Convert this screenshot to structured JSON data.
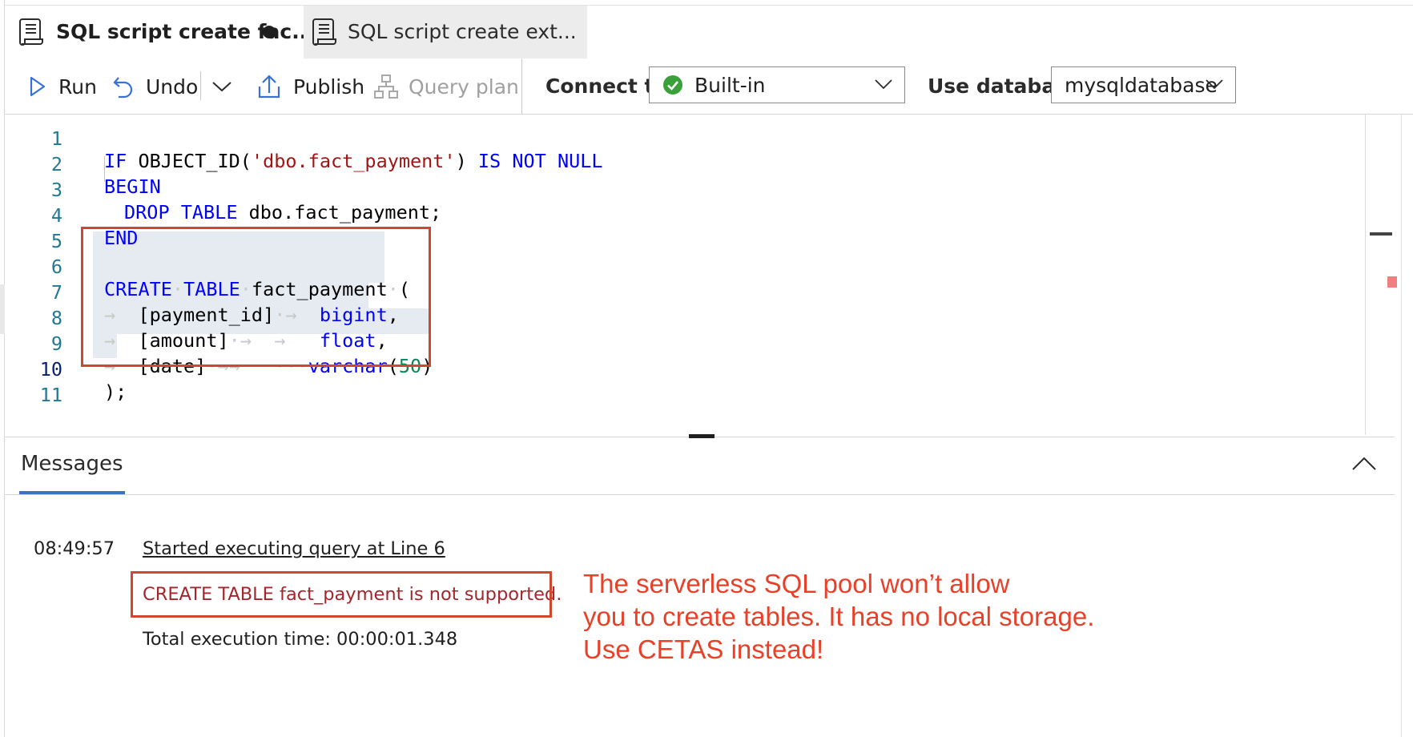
{
  "tabs": [
    {
      "label": "SQL script create fac...",
      "active": true,
      "unsaved": true
    },
    {
      "label": "SQL script create ext...",
      "active": false
    }
  ],
  "toolbar": {
    "run_label": "Run",
    "undo_label": "Undo",
    "publish_label": "Publish",
    "query_plan_label": "Query plan",
    "connect_to_label": "Connect to",
    "connect_to_value": "Built-in",
    "use_database_label": "Use database",
    "use_database_value": "mysqldatabase"
  },
  "editor": {
    "line_numbers": [
      "1",
      "2",
      "3",
      "4",
      "5",
      "6",
      "7",
      "8",
      "9",
      "10",
      "11"
    ],
    "active_line": 10,
    "lines": [
      "IF OBJECT_ID('dbo.fact_payment') IS NOT NULL",
      "BEGIN",
      "DROP TABLE dbo.fact_payment;",
      "END",
      "",
      "CREATE TABLE fact_payment (",
      "[payment_id] bigint,",
      "[amount] float,",
      "[date] varchar(50)",
      ");",
      ""
    ]
  },
  "messages": {
    "tab_label": "Messages",
    "time": "08:49:57",
    "started": "Started executing query at Line 6",
    "error": "CREATE TABLE fact_payment is not supported.",
    "total": "Total execution time: 00:00:01.348"
  },
  "annotation": {
    "callout_lines": [
      "The serverless SQL pool won’t allow",
      "you to create tables. It has no local storage.",
      "Use CETAS instead!"
    ]
  },
  "colors": {
    "keyword": "#0000ff",
    "string": "#a31515",
    "number": "#098658",
    "annotation_red": "#d0472e",
    "error_text": "#a4262c",
    "success_green": "#3aa13a"
  }
}
